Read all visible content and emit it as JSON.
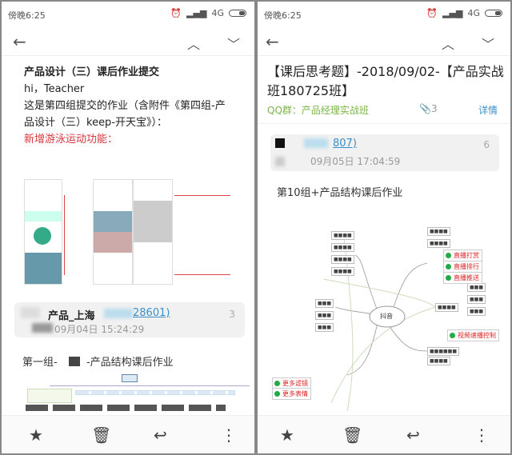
{
  "left": {
    "status": {
      "time": "傍晚6:25",
      "network": "4G"
    },
    "subject": "产品设计（三）课后作业提交",
    "greeting": "hi，Teacher",
    "body_line1": "这是第四组提交的作业（含附件《第四组-产",
    "body_line2": "品设计（三）keep-开天宝》）：",
    "highlight": "新增游泳运动功能：",
    "sender": {
      "name": "产品_上海",
      "id_suffix": "28601)",
      "date": "09月04日 15:24:29",
      "count": "3"
    },
    "second_body": "第一组-",
    "second_body_suffix": "-产品结构课后作业"
  },
  "right": {
    "status": {
      "time": "傍晚6:25",
      "network": "4G"
    },
    "subject": "【课后思考题】-2018/09/02-【产品实战班180725班】",
    "group": "QQ群：产品经理实战班",
    "attachments": "3",
    "details": "详情",
    "sender": {
      "id_suffix": "807)",
      "date": "09月05日 17:04:59",
      "count": "6"
    },
    "body": "第10组+产品结构课后作业",
    "mindmap": {
      "center": "抖音",
      "added": [
        "直播打赏",
        "直播排行",
        "直播推送",
        "视频速播控制",
        "更多滤镜",
        "更多表情"
      ]
    }
  },
  "colors": {
    "red": "#d9363e",
    "green": "#7ab648",
    "link": "#3a8fc8"
  }
}
